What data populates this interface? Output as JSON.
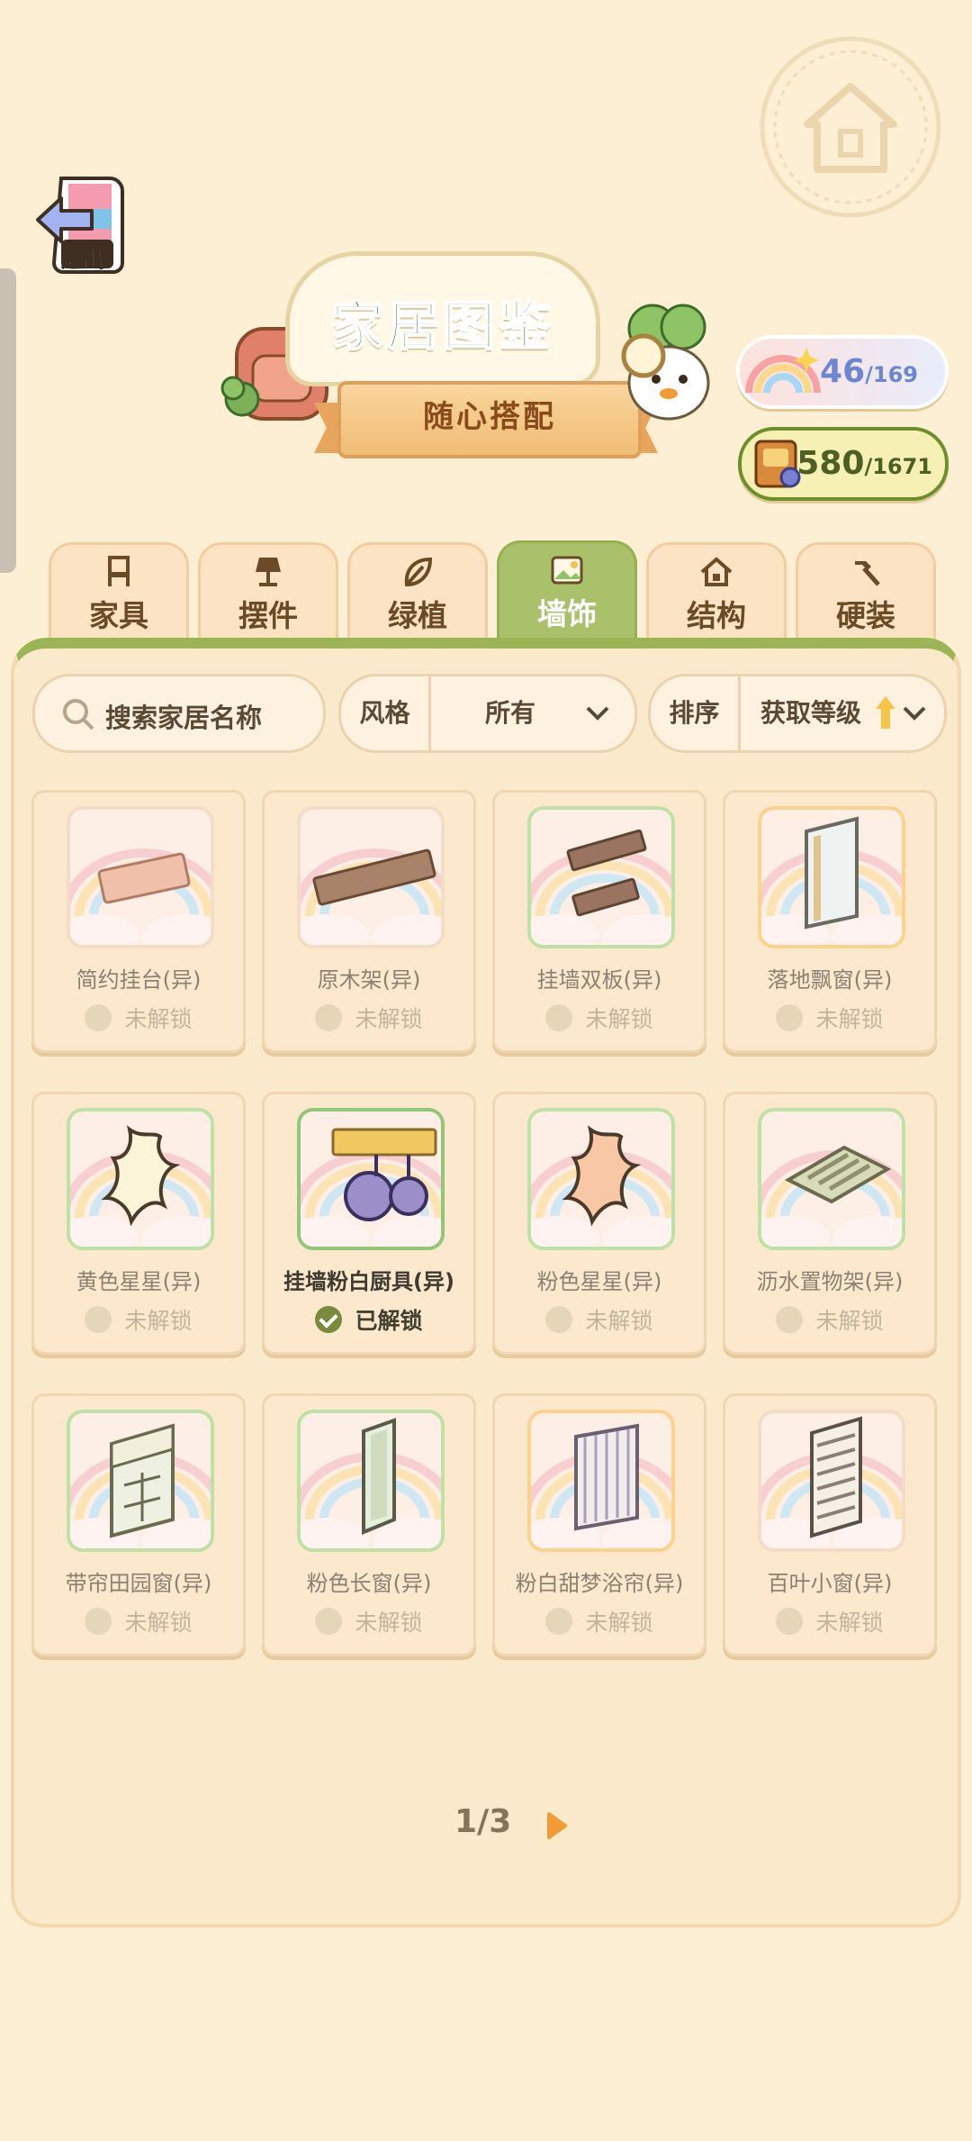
{
  "header": {
    "exit_label": "退出",
    "title": "家居图鉴",
    "subtitle": "随心搭配"
  },
  "counters": {
    "rainbow": {
      "value": "46",
      "total": "/169"
    },
    "book": {
      "value": "580",
      "total": "/1671"
    }
  },
  "tabs": [
    {
      "label": "家具",
      "icon": "chair-icon"
    },
    {
      "label": "摆件",
      "icon": "lamp-icon"
    },
    {
      "label": "绿植",
      "icon": "leaf-icon"
    },
    {
      "label": "墙饰",
      "icon": "picture-icon",
      "active": true
    },
    {
      "label": "结构",
      "icon": "house-icon"
    },
    {
      "label": "硬装",
      "icon": "hammer-icon"
    }
  ],
  "search": {
    "placeholder": "搜索家居名称"
  },
  "filters": {
    "style_key": "风格",
    "style_value": "所有",
    "sort_key": "排序",
    "sort_value": "获取等级"
  },
  "items": [
    {
      "name": "简约挂台(异)",
      "status": "未解锁",
      "owned": false,
      "frame": "pink",
      "icon": "shelf-board-icon"
    },
    {
      "name": "原木架(异)",
      "status": "未解锁",
      "owned": false,
      "frame": "pink",
      "icon": "wood-shelf-icon"
    },
    {
      "name": "挂墙双板(异)",
      "status": "未解锁",
      "owned": false,
      "frame": "green",
      "icon": "double-board-icon"
    },
    {
      "name": "落地飘窗(异)",
      "status": "未解锁",
      "owned": false,
      "frame": "gold",
      "icon": "bay-window-icon"
    },
    {
      "name": "黄色星星(异)",
      "status": "未解锁",
      "owned": false,
      "frame": "green",
      "icon": "yellow-star-icon"
    },
    {
      "name": "挂墙粉白厨具(异)",
      "status": "已解锁",
      "owned": true,
      "frame": "owned",
      "icon": "kitchenware-icon"
    },
    {
      "name": "粉色星星(异)",
      "status": "未解锁",
      "owned": false,
      "frame": "green",
      "icon": "pink-star-icon"
    },
    {
      "name": "沥水置物架(异)",
      "status": "未解锁",
      "owned": false,
      "frame": "green",
      "icon": "drain-rack-icon"
    },
    {
      "name": "带帘田园窗(异)",
      "status": "未解锁",
      "owned": false,
      "frame": "green",
      "icon": "curtain-window-icon"
    },
    {
      "name": "粉色长窗(异)",
      "status": "未解锁",
      "owned": false,
      "frame": "green",
      "icon": "long-window-icon"
    },
    {
      "name": "粉白甜梦浴帘(异)",
      "status": "未解锁",
      "owned": false,
      "frame": "gold",
      "icon": "shower-curtain-icon"
    },
    {
      "name": "百叶小窗(异)",
      "status": "未解锁",
      "owned": false,
      "frame": "pink",
      "icon": "louver-window-icon"
    }
  ],
  "pagination": {
    "text": "1/3"
  },
  "colors": {
    "background": "#fdefd3",
    "active_tab": "#a8c16a",
    "title_green": "#3f6d2a",
    "counter_blue": "#6e86d1",
    "next_arrow": "#f29a34"
  }
}
